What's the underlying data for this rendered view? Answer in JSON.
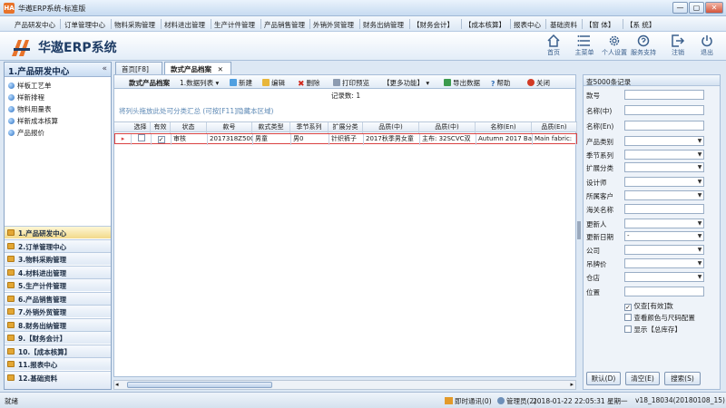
{
  "window": {
    "title": "华遨ERP系统-标准版",
    "min": "—",
    "max": "▢",
    "close": "✕"
  },
  "menu": [
    "产品研发中心",
    "订单管理中心",
    "物料采购管理",
    "材料进出管理",
    "生产计件管理",
    "产品销售管理",
    "外销外贸管理",
    "财务出纳管理",
    "【财务会计】",
    "【成本核算】",
    "报表中心",
    "基础资料",
    "【窗 体】",
    "【系 统】"
  ],
  "header": {
    "brand": "华遨ERP系统",
    "buttons": [
      {
        "label": "首页",
        "icon": "home-icon"
      },
      {
        "label": "主菜单",
        "icon": "menu-list-icon"
      },
      {
        "label": "个人设置",
        "icon": "gear-icon"
      },
      {
        "label": "服务支持",
        "icon": "support-icon"
      },
      {
        "label": "注销",
        "icon": "logout-icon"
      },
      {
        "label": "退出",
        "icon": "power-icon"
      }
    ]
  },
  "left_panel": {
    "title": "1.产品研发中心",
    "collapse": "«",
    "sub_items": [
      "样板工艺单",
      "样新排程",
      "物料用量表",
      "样新成本核算",
      "产品报价"
    ],
    "modules": [
      "1.产品研发中心",
      "2.订单管理中心",
      "3.物料采购管理",
      "4.材料进出管理",
      "5.生产计件管理",
      "6.产品销售管理",
      "7.外销外贸管理",
      "8.财务出纳管理",
      "9.【财务会计】",
      "10.【成本核算】",
      "11.报表中心",
      "12.基础资料"
    ]
  },
  "tabs": [
    {
      "label": "首页[F8]"
    },
    {
      "label": "款式产品档案",
      "close": "✕"
    }
  ],
  "toolbar": {
    "title": "款式产品档案",
    "list": "1.数据列表",
    "new": "新建",
    "edit": "编辑",
    "delete": "删除",
    "print": "打印预览",
    "more": "【更多功能】",
    "export": "导出数据",
    "help": "帮助",
    "close": "关闭"
  },
  "grid": {
    "record_count": "记录数: 1",
    "group_hint": "将列头拖放此处可分类汇总 (可按[F11]隐藏本区域)",
    "headers": [
      "选择",
      "有效",
      "状态",
      "款号",
      "款式类型",
      "季节系列",
      "扩展分类",
      "品质(中)",
      "品质(中)",
      "名称(En)",
      "品质(En)"
    ],
    "rows": [
      {
        "select": "",
        "valid": "✓",
        "status": "审核",
        "code": "2017318Z500",
        "type": "男童",
        "season": "男0",
        "ext": "针织裤子",
        "quality_cn1": "2017秋季男女童",
        "quality_cn2": "主布: 32SCVC双",
        "name_en": "Autumn 2017 Ba",
        "quality_en": "Main fabric:"
      }
    ]
  },
  "right_panel": {
    "title": "查5000条记录",
    "fields": [
      {
        "label": "款号",
        "value": "",
        "dropdown": false
      },
      {
        "label": "名称(中)",
        "value": "",
        "dropdown": false
      },
      {
        "label": "名称(En)",
        "value": "",
        "dropdown": false
      },
      {
        "label": "产品类别",
        "value": "",
        "dropdown": true
      },
      {
        "label": "季节系列",
        "value": "",
        "dropdown": true
      },
      {
        "label": "扩展分类",
        "value": "",
        "dropdown": true
      },
      {
        "label": "设计师",
        "value": "",
        "dropdown": true
      },
      {
        "label": "所属客户",
        "value": "",
        "dropdown": true
      },
      {
        "label": "海关名称",
        "value": "",
        "dropdown": false
      },
      {
        "label": "更新人",
        "value": "",
        "dropdown": true
      },
      {
        "label": "更新日期",
        "value": "-",
        "dropdown": true
      },
      {
        "label": "公司",
        "value": "",
        "dropdown": true
      },
      {
        "label": "吊牌价",
        "value": "",
        "dropdown": true
      },
      {
        "label": "仓店",
        "value": "",
        "dropdown": true
      },
      {
        "label": "位置",
        "value": "",
        "dropdown": false
      }
    ],
    "checks": [
      {
        "label": "仅查[有效]款",
        "checked": "✓"
      },
      {
        "label": "查看颜色与尺码配置",
        "checked": ""
      },
      {
        "label": "显示【总库存】",
        "checked": ""
      }
    ],
    "buttons": {
      "default": "默认(D)",
      "clear": "清空(E)",
      "search": "搜索(S)"
    }
  },
  "status": {
    "left": "就绪",
    "messenger": "即时通讯(0)",
    "user": "管理员(2)",
    "datetime": "2018-01-22  22:05:31  星期一",
    "version": "v18_18034(20180108_15)"
  },
  "colors": {
    "accent": "#e8732a",
    "brand": "#1f3d66",
    "selected_row_border": "#d94141"
  }
}
